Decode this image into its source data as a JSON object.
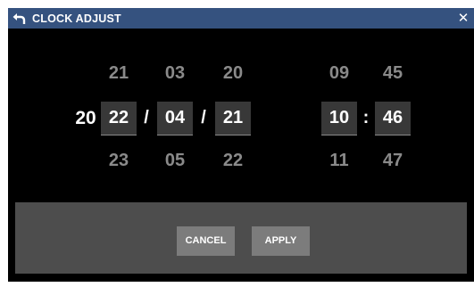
{
  "window": {
    "title": "CLOCK ADJUST",
    "close_glyph": "✕",
    "back_icon": "back-arrow-icon"
  },
  "date": {
    "century": "20",
    "separator_1": "/",
    "separator_2": "/",
    "year": {
      "prev": "21",
      "current": "22",
      "next": "23"
    },
    "month": {
      "prev": "03",
      "current": "04",
      "next": "05"
    },
    "day": {
      "prev": "20",
      "current": "21",
      "next": "22"
    }
  },
  "time": {
    "separator": ":",
    "hour": {
      "prev": "09",
      "current": "10",
      "next": "11"
    },
    "minute": {
      "prev": "45",
      "current": "46",
      "next": "47"
    }
  },
  "buttons": {
    "cancel_label": "CANCEL",
    "apply_label": "APPLY"
  },
  "colors": {
    "titlebar": "#35527f",
    "background": "#000000",
    "selected_box": "#383838",
    "dim_text": "#8a8a8a",
    "button_panel": "#4d4d4d",
    "button": "#7c7c7c"
  }
}
